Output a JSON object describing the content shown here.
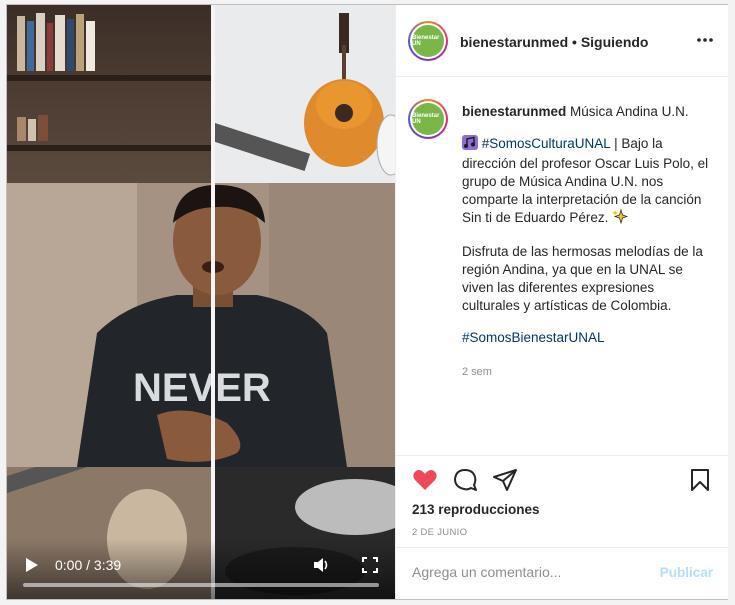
{
  "post": {
    "username": "bienestarunmed",
    "follow_status": "• Siguiendo",
    "avatar_text": "Bienestar UN",
    "caption_title": "Música Andina U.N.",
    "paragraph1_tag": "#SomosCulturaUNAL",
    "paragraph1_text": " | Bajo la dirección del profesor Oscar Luis Polo, el grupo de Música Andina U.N. nos comparte la interpretación de la canción Sin ti de Eduardo Pérez. ",
    "paragraph2": "Disfruta de las hermosas melodías de la región Andina, ya que en la UNAL se viven las diferentes expresiones culturales y artísticas de Colombia.",
    "hashtag2": "#SomosBienestarUNAL",
    "posted_ago": "2 sem",
    "views": "213 reproducciones",
    "date": "2 DE JUNIO"
  },
  "video": {
    "time": "0:00 / 3:39",
    "progress": 0.0,
    "shirt_text": "NEVER"
  },
  "comment": {
    "placeholder": "Agrega un comentario...",
    "publish_label": "Publicar"
  },
  "colors": {
    "heart": "#ed4956",
    "tag": "#00376b",
    "publish": "#b2dffc",
    "avatar_green": "#7ab648"
  },
  "icons": {
    "play": "play-icon",
    "volume": "volume-icon",
    "fullscreen": "fullscreen-icon",
    "more": "more-icon",
    "heart": "heart-icon",
    "comment": "comment-icon",
    "share": "share-icon",
    "save": "bookmark-icon"
  }
}
